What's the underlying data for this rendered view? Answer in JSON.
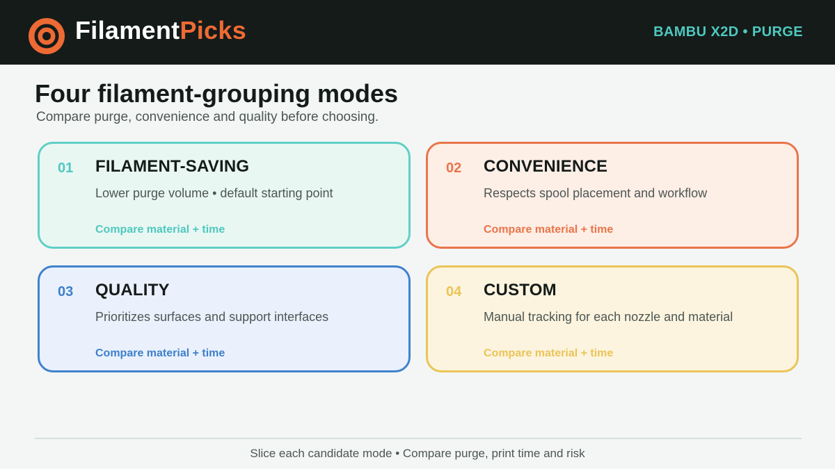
{
  "header": {
    "brand_part1": "Filament",
    "brand_part2": "Picks",
    "tag": "BAMBU X2D • PURGE"
  },
  "page": {
    "title": "Four filament-grouping modes",
    "subtitle": "Compare purge, convenience and quality before choosing."
  },
  "modes": [
    {
      "number": "01",
      "title": "FILAMENT-SAVING",
      "description": "Lower purge volume • default starting point",
      "link": "Compare material + time",
      "accent": "#4fc8bf"
    },
    {
      "number": "02",
      "title": "CONVENIENCE",
      "description": "Respects spool placement and workflow",
      "link": "Compare material + time",
      "accent": "#e9754a"
    },
    {
      "number": "03",
      "title": "QUALITY",
      "description": "Prioritizes surfaces and support interfaces",
      "link": "Compare material + time",
      "accent": "#3d7fcb"
    },
    {
      "number": "04",
      "title": "CUSTOM",
      "description": "Manual tracking for each nozzle and material",
      "link": "Compare material + time",
      "accent": "#ebc458"
    }
  ],
  "footer": {
    "text": "Slice each candidate mode • Compare purge, print time and risk"
  },
  "colors": {
    "header_bg": "#141b19",
    "brand_accent": "#ee6a34",
    "tag": "#4fc8bf",
    "page_bg": "#f3f6f5"
  },
  "icons": {
    "logo": "filament-spool-icon"
  }
}
